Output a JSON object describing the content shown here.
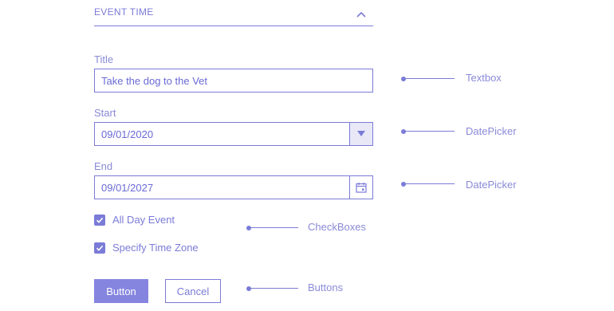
{
  "section": {
    "title": "EVENT TIME"
  },
  "form": {
    "title": {
      "label": "Title",
      "value": "Take the dog to the Vet"
    },
    "start": {
      "label": "Start",
      "value": "09/01/2020"
    },
    "end": {
      "label": "End",
      "value": "09/01/2027"
    },
    "checkboxes": [
      {
        "label": "All Day Event",
        "checked": true
      },
      {
        "label": "Specify Time Zone",
        "checked": true
      }
    ],
    "buttons": {
      "primary": "Button",
      "secondary": "Cancel"
    }
  },
  "callouts": {
    "textbox": "Textbox",
    "start_picker": "DatePicker",
    "end_picker": "DatePicker",
    "checkboxes": "CheckBoxes",
    "buttons": "Buttons"
  },
  "colors": {
    "accent": "#7b7bd8",
    "button_fill": "#8585e0",
    "dropdown_fill": "#e8e8f7"
  },
  "icons": {
    "collapse": "chevron-up-icon",
    "dropdown": "triangle-down-icon",
    "calendar": "calendar-icon",
    "check": "checkmark-icon"
  }
}
